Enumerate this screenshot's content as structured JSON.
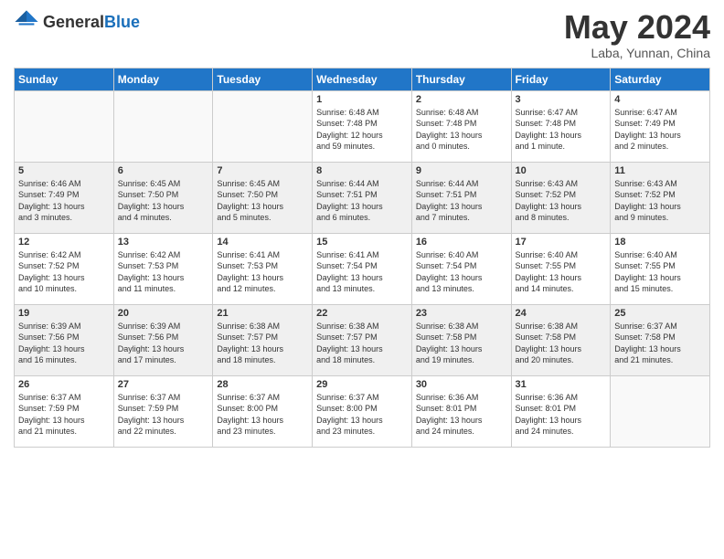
{
  "header": {
    "logo_general": "General",
    "logo_blue": "Blue",
    "month_title": "May 2024",
    "subtitle": "Laba, Yunnan, China"
  },
  "days_of_week": [
    "Sunday",
    "Monday",
    "Tuesday",
    "Wednesday",
    "Thursday",
    "Friday",
    "Saturday"
  ],
  "weeks": [
    [
      {
        "day": "",
        "info": ""
      },
      {
        "day": "",
        "info": ""
      },
      {
        "day": "",
        "info": ""
      },
      {
        "day": "1",
        "info": "Sunrise: 6:48 AM\nSunset: 7:48 PM\nDaylight: 12 hours\nand 59 minutes."
      },
      {
        "day": "2",
        "info": "Sunrise: 6:48 AM\nSunset: 7:48 PM\nDaylight: 13 hours\nand 0 minutes."
      },
      {
        "day": "3",
        "info": "Sunrise: 6:47 AM\nSunset: 7:48 PM\nDaylight: 13 hours\nand 1 minute."
      },
      {
        "day": "4",
        "info": "Sunrise: 6:47 AM\nSunset: 7:49 PM\nDaylight: 13 hours\nand 2 minutes."
      }
    ],
    [
      {
        "day": "5",
        "info": "Sunrise: 6:46 AM\nSunset: 7:49 PM\nDaylight: 13 hours\nand 3 minutes."
      },
      {
        "day": "6",
        "info": "Sunrise: 6:45 AM\nSunset: 7:50 PM\nDaylight: 13 hours\nand 4 minutes."
      },
      {
        "day": "7",
        "info": "Sunrise: 6:45 AM\nSunset: 7:50 PM\nDaylight: 13 hours\nand 5 minutes."
      },
      {
        "day": "8",
        "info": "Sunrise: 6:44 AM\nSunset: 7:51 PM\nDaylight: 13 hours\nand 6 minutes."
      },
      {
        "day": "9",
        "info": "Sunrise: 6:44 AM\nSunset: 7:51 PM\nDaylight: 13 hours\nand 7 minutes."
      },
      {
        "day": "10",
        "info": "Sunrise: 6:43 AM\nSunset: 7:52 PM\nDaylight: 13 hours\nand 8 minutes."
      },
      {
        "day": "11",
        "info": "Sunrise: 6:43 AM\nSunset: 7:52 PM\nDaylight: 13 hours\nand 9 minutes."
      }
    ],
    [
      {
        "day": "12",
        "info": "Sunrise: 6:42 AM\nSunset: 7:52 PM\nDaylight: 13 hours\nand 10 minutes."
      },
      {
        "day": "13",
        "info": "Sunrise: 6:42 AM\nSunset: 7:53 PM\nDaylight: 13 hours\nand 11 minutes."
      },
      {
        "day": "14",
        "info": "Sunrise: 6:41 AM\nSunset: 7:53 PM\nDaylight: 13 hours\nand 12 minutes."
      },
      {
        "day": "15",
        "info": "Sunrise: 6:41 AM\nSunset: 7:54 PM\nDaylight: 13 hours\nand 13 minutes."
      },
      {
        "day": "16",
        "info": "Sunrise: 6:40 AM\nSunset: 7:54 PM\nDaylight: 13 hours\nand 13 minutes."
      },
      {
        "day": "17",
        "info": "Sunrise: 6:40 AM\nSunset: 7:55 PM\nDaylight: 13 hours\nand 14 minutes."
      },
      {
        "day": "18",
        "info": "Sunrise: 6:40 AM\nSunset: 7:55 PM\nDaylight: 13 hours\nand 15 minutes."
      }
    ],
    [
      {
        "day": "19",
        "info": "Sunrise: 6:39 AM\nSunset: 7:56 PM\nDaylight: 13 hours\nand 16 minutes."
      },
      {
        "day": "20",
        "info": "Sunrise: 6:39 AM\nSunset: 7:56 PM\nDaylight: 13 hours\nand 17 minutes."
      },
      {
        "day": "21",
        "info": "Sunrise: 6:38 AM\nSunset: 7:57 PM\nDaylight: 13 hours\nand 18 minutes."
      },
      {
        "day": "22",
        "info": "Sunrise: 6:38 AM\nSunset: 7:57 PM\nDaylight: 13 hours\nand 18 minutes."
      },
      {
        "day": "23",
        "info": "Sunrise: 6:38 AM\nSunset: 7:58 PM\nDaylight: 13 hours\nand 19 minutes."
      },
      {
        "day": "24",
        "info": "Sunrise: 6:38 AM\nSunset: 7:58 PM\nDaylight: 13 hours\nand 20 minutes."
      },
      {
        "day": "25",
        "info": "Sunrise: 6:37 AM\nSunset: 7:58 PM\nDaylight: 13 hours\nand 21 minutes."
      }
    ],
    [
      {
        "day": "26",
        "info": "Sunrise: 6:37 AM\nSunset: 7:59 PM\nDaylight: 13 hours\nand 21 minutes."
      },
      {
        "day": "27",
        "info": "Sunrise: 6:37 AM\nSunset: 7:59 PM\nDaylight: 13 hours\nand 22 minutes."
      },
      {
        "day": "28",
        "info": "Sunrise: 6:37 AM\nSunset: 8:00 PM\nDaylight: 13 hours\nand 23 minutes."
      },
      {
        "day": "29",
        "info": "Sunrise: 6:37 AM\nSunset: 8:00 PM\nDaylight: 13 hours\nand 23 minutes."
      },
      {
        "day": "30",
        "info": "Sunrise: 6:36 AM\nSunset: 8:01 PM\nDaylight: 13 hours\nand 24 minutes."
      },
      {
        "day": "31",
        "info": "Sunrise: 6:36 AM\nSunset: 8:01 PM\nDaylight: 13 hours\nand 24 minutes."
      },
      {
        "day": "",
        "info": ""
      }
    ]
  ]
}
